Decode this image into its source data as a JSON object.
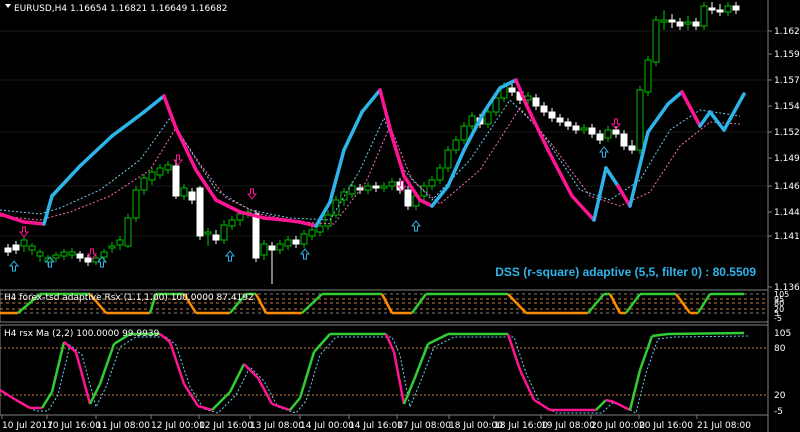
{
  "main": {
    "symbol_line": "EURUSD,H4  1.16654 1.16821 1.16649 1.16682",
    "price_labels": [
      "1.16240",
      "1.15980",
      "1.15720",
      "1.15460",
      "1.15205",
      "1.14950",
      "1.14685",
      "1.14430",
      "1.14170",
      "1.13655"
    ],
    "dss_label": "DSS (r-square) adaptive (5,5, filter 0) : 80.5509"
  },
  "sub1": {
    "title": "H4 forex-tsd adaptive Rsx (1.1,1.00) 100.0000 87.4192",
    "scale_labels": [
      "105",
      "95",
      "80",
      "20",
      "5",
      "-5"
    ]
  },
  "sub2": {
    "title": "H4 rsx Ma (2,2) 100.0000 99.9939",
    "scale_labels": [
      "105",
      "80",
      "20",
      "-5"
    ]
  },
  "time_labels": [
    "10 Jul 2017",
    "10 Jul 16:00",
    "11 Jul 08:00",
    "12 Jul 00:00",
    "12 Jul 16:00",
    "13 Jul 08:00",
    "14 Jul 00:00",
    "14 Jul 16:00",
    "17 Jul 08:00",
    "18 Jul 00:00",
    "18 Jul 16:00",
    "19 Jul 08:00",
    "20 Jul 00:00",
    "20 Jul 16:00",
    "21 Jul 08:00"
  ],
  "colors": {
    "background": "#000000",
    "bull_candle": "#00c000",
    "bear_candle": "#ffffff",
    "dss_up": "#2fb4ea",
    "dss_down": "#ff1493",
    "rsx_up": "#32cd32",
    "rsx_down": "#ff8c00",
    "level_line": "#c08040"
  },
  "icons": {
    "menu_icon": "triangle-down-icon",
    "up_arrow": "up-arrow-icon",
    "down_arrow": "down-arrow-icon"
  }
}
